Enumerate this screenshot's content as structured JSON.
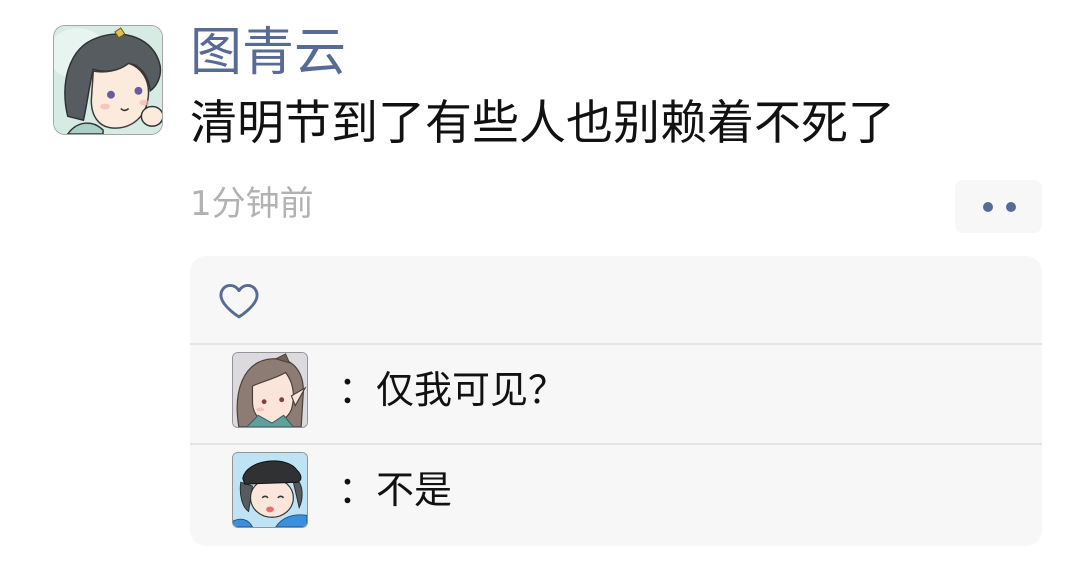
{
  "post": {
    "author": "图青云",
    "text": "清明节到了有些人也别赖着不死了",
    "time": "1分钟前"
  },
  "comments": [
    {
      "text": "：仅我可见？"
    },
    {
      "text": "：不是"
    }
  ],
  "icons": {
    "more": "more-dots-icon",
    "like": "heart-icon"
  },
  "colors": {
    "link": "#576b95",
    "panel": "#f7f7f7",
    "divider": "#e4e4e4",
    "text": "#111111",
    "meta": "#b2b2b2"
  }
}
